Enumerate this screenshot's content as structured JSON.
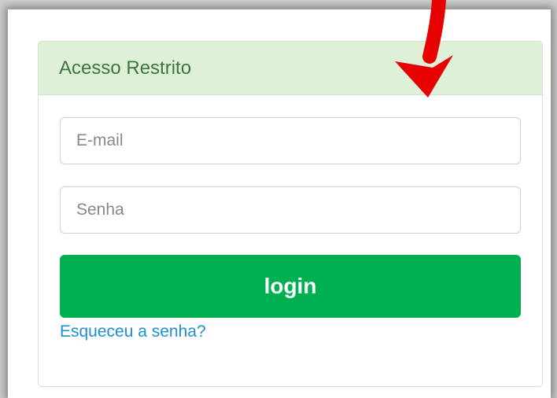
{
  "panel": {
    "title": "Acesso Restrito"
  },
  "form": {
    "email_placeholder": "E-mail",
    "password_placeholder": "Senha",
    "login_label": "login",
    "forgot_label": "Esqueceu a senha?"
  },
  "annotation": {
    "icon": "arrow-down-icon",
    "color": "#e60000"
  },
  "colors": {
    "header_bg": "#dff0d8",
    "title": "#3c763d",
    "button": "#00b050",
    "link": "#1e8fd0"
  }
}
